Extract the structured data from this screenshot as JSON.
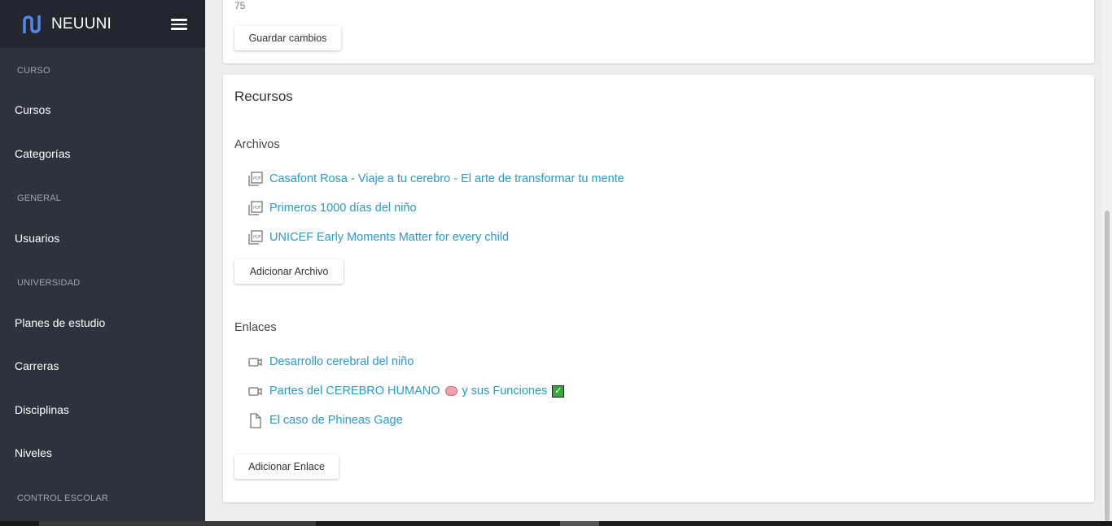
{
  "sidebar": {
    "brand": "NEUUNI",
    "sections": {
      "curso": "CURSO",
      "general": "GENERAL",
      "universidad": "UNIVERSIDAD",
      "control": "CONTROL ESCOLAR"
    },
    "items": {
      "cursos": "Cursos",
      "categorias": "Categorías",
      "usuarios": "Usuarios",
      "planes": "Planes de estudio",
      "carreras": "Carreras",
      "disciplinas": "Disciplinas",
      "niveles": "Niveles"
    }
  },
  "top_card": {
    "value": "75",
    "save_label": "Guardar cambios"
  },
  "resources": {
    "title": "Recursos",
    "files_title": "Archivos",
    "files": [
      {
        "label": "Casafont Rosa - Viaje a tu cerebro - El arte de transformar tu mente",
        "icon": "pdf-icon"
      },
      {
        "label": "Primeros 1000 días del niño",
        "icon": "pdf-icon"
      },
      {
        "label": "UNICEF Early Moments Matter for every child",
        "icon": "pdf-icon"
      }
    ],
    "add_file_label": "Adicionar Archivo",
    "links_title": "Enlaces",
    "links": [
      {
        "label": "Desarrollo cerebral del niño",
        "icon": "video-icon"
      },
      {
        "label_a": "Partes del CEREBRO HUMANO",
        "label_b": "y sus Funciones",
        "icon": "video-icon"
      },
      {
        "label": "El caso de Phineas Gage",
        "icon": "document-icon"
      }
    ],
    "add_link_label": "Adicionar Enlace"
  },
  "colors": {
    "sidebar_bg": "#2e323d",
    "sidebar_header_bg": "#23262e",
    "link": "#2a9bc4",
    "logo": "#4f86e8"
  }
}
